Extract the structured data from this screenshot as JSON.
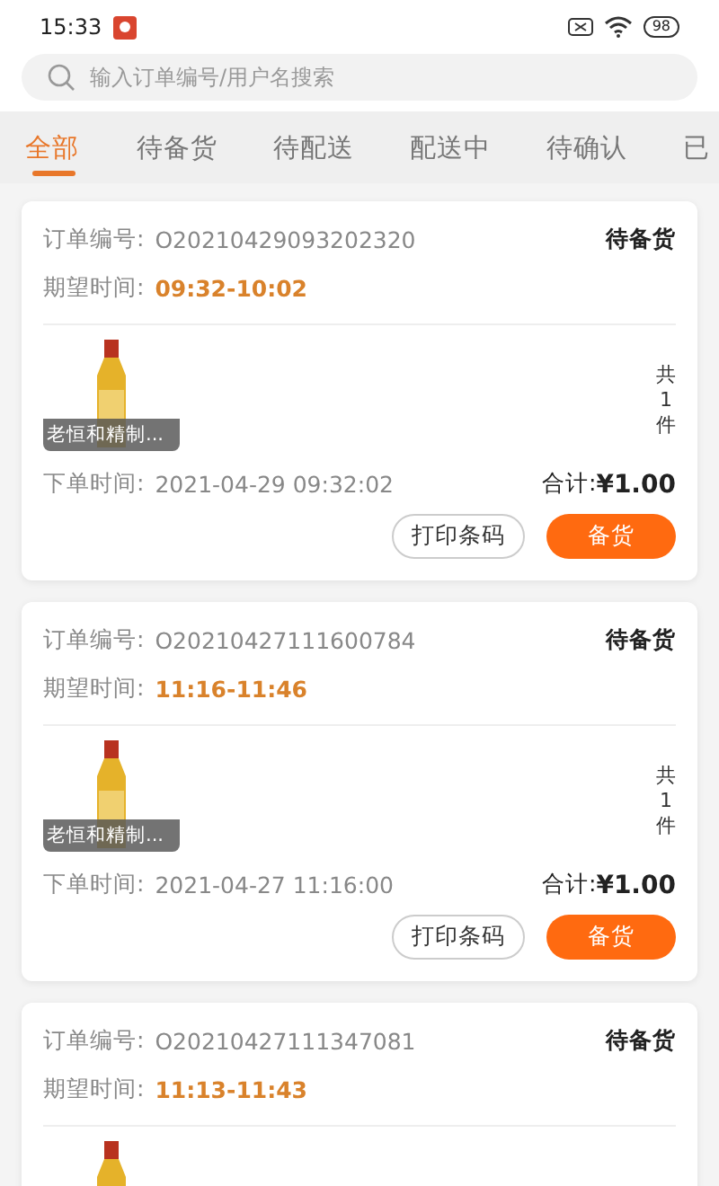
{
  "status_bar": {
    "time": "15:33",
    "battery": "98"
  },
  "search": {
    "placeholder": "输入订单编号/用户名搜索"
  },
  "tabs": [
    {
      "label": "全部",
      "selected": true
    },
    {
      "label": "待备货",
      "selected": false
    },
    {
      "label": "待配送",
      "selected": false
    },
    {
      "label": "配送中",
      "selected": false
    },
    {
      "label": "待确认",
      "selected": false
    },
    {
      "label": "已",
      "selected": false
    }
  ],
  "orders": [
    {
      "order_label": "订单编号:",
      "order_no": "O20210429093202320",
      "status": "待备货",
      "expect_label": "期望时间:",
      "expect_time": "09:32-10:02",
      "product_name": "老恒和精制...",
      "qty": [
        "共",
        "1",
        "件"
      ],
      "placed_label": "下单时间:",
      "placed_time": "2021-04-29 09:32:02",
      "total_label": "合计:",
      "total": "¥1.00",
      "buttons": [
        "打印条码",
        "备货"
      ]
    },
    {
      "order_label": "订单编号:",
      "order_no": "O20210427111600784",
      "status": "待备货",
      "expect_label": "期望时间:",
      "expect_time": "11:16-11:46",
      "product_name": "老恒和精制...",
      "qty": [
        "共",
        "1",
        "件"
      ],
      "placed_label": "下单时间:",
      "placed_time": "2021-04-27 11:16:00",
      "total_label": "合计:",
      "total": "¥1.00",
      "buttons": [
        "打印条码",
        "备货"
      ]
    },
    {
      "order_label": "订单编号:",
      "order_no": "O20210427111347081",
      "status": "待备货",
      "expect_label": "期望时间:",
      "expect_time": "11:13-11:43"
    }
  ]
}
